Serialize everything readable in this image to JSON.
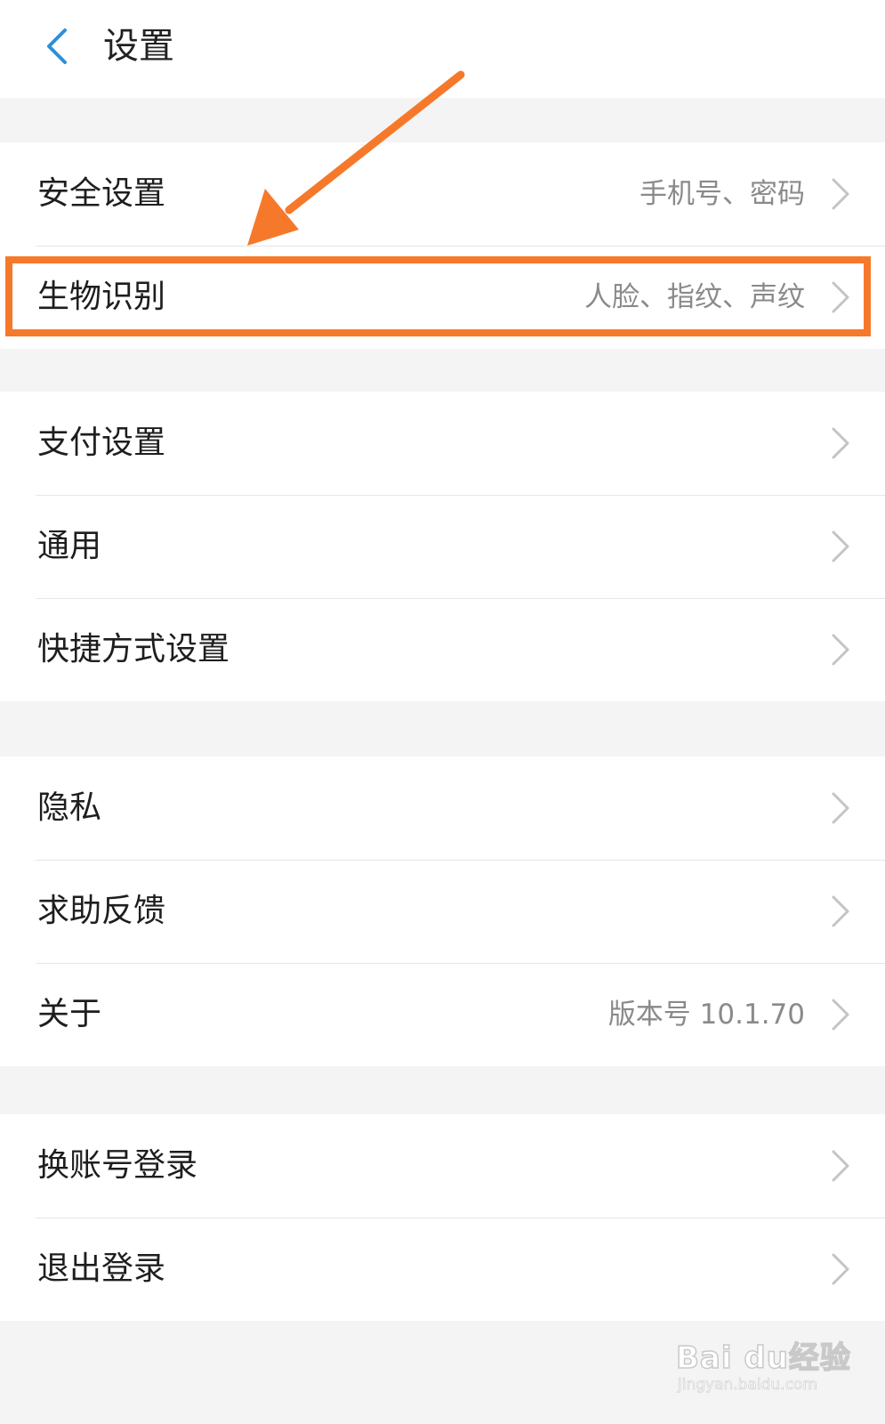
{
  "header": {
    "title": "设置",
    "back_icon": "chevron-left-icon",
    "accent_color": "#2d8fd8"
  },
  "groups": [
    {
      "items": [
        {
          "label": "安全设置",
          "value": "手机号、密码"
        },
        {
          "label": "生物识别",
          "value": "人脸、指纹、声纹"
        }
      ]
    },
    {
      "items": [
        {
          "label": "支付设置",
          "value": ""
        },
        {
          "label": "通用",
          "value": ""
        },
        {
          "label": "快捷方式设置",
          "value": ""
        }
      ]
    },
    {
      "items": [
        {
          "label": "隐私",
          "value": ""
        },
        {
          "label": "求助反馈",
          "value": ""
        },
        {
          "label": "关于",
          "value": "版本号 10.1.70"
        }
      ]
    },
    {
      "items": [
        {
          "label": "换账号登录",
          "value": ""
        },
        {
          "label": "退出登录",
          "value": ""
        }
      ]
    }
  ],
  "annotation": {
    "color": "#f6792b",
    "highlighted_item": "生物识别"
  },
  "watermark": {
    "brand": "Bai du经验",
    "url": "jingyan.baidu.com"
  }
}
